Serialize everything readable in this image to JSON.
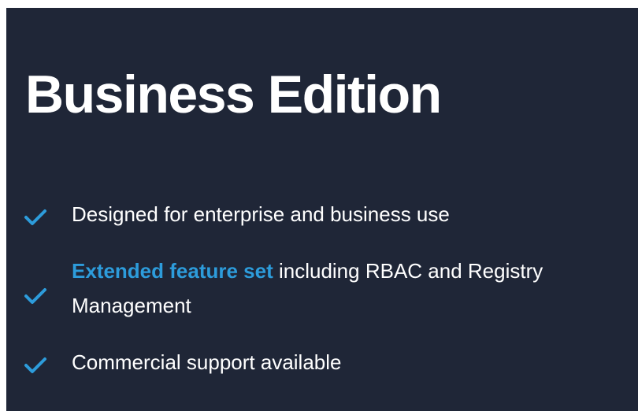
{
  "card": {
    "title": "Business Edition",
    "features": [
      {
        "text": "Designed for enterprise and business use"
      },
      {
        "highlight": "Extended feature set",
        "text": " including RBAC and Registry Management"
      },
      {
        "text": "Commercial support available"
      }
    ]
  },
  "colors": {
    "background": "#1f2637",
    "text": "#ffffff",
    "accent": "#2d9cdb"
  },
  "icons": {
    "check": "check-icon"
  }
}
